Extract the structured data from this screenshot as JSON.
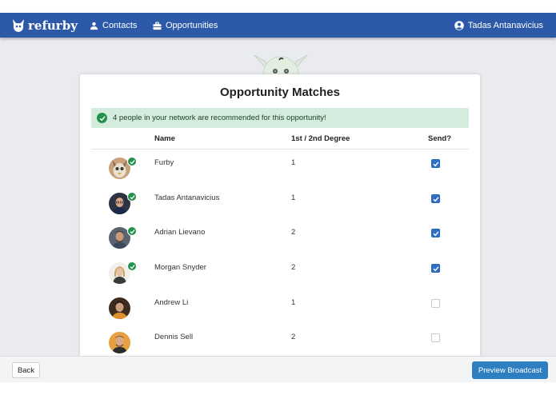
{
  "navbar": {
    "brand": "refurby",
    "contacts_label": "Contacts",
    "opportunities_label": "Opportunities",
    "user_name": "Tadas Antanavicius",
    "brand_color": "#2d5aa8"
  },
  "card": {
    "title": "Opportunity Matches",
    "alert_text": "4 people in your network are recommended for this opportunity!",
    "headers": {
      "name": "Name",
      "degree": "1st / 2nd Degree",
      "send": "Send?"
    },
    "rows": [
      {
        "name": "Furby",
        "degree": "1",
        "send": true,
        "recommended": true
      },
      {
        "name": "Tadas Antanavicius",
        "degree": "1",
        "send": true,
        "recommended": true
      },
      {
        "name": "Adrian Lievano",
        "degree": "2",
        "send": true,
        "recommended": true
      },
      {
        "name": "Morgan Snyder",
        "degree": "2",
        "send": true,
        "recommended": true
      },
      {
        "name": "Andrew Li",
        "degree": "1",
        "send": false,
        "recommended": false
      },
      {
        "name": "Dennis Sell",
        "degree": "2",
        "send": false,
        "recommended": false
      }
    ]
  },
  "footer": {
    "back_label": "Back",
    "preview_label": "Preview Broadcast",
    "preview_color": "#2e7fc1"
  }
}
